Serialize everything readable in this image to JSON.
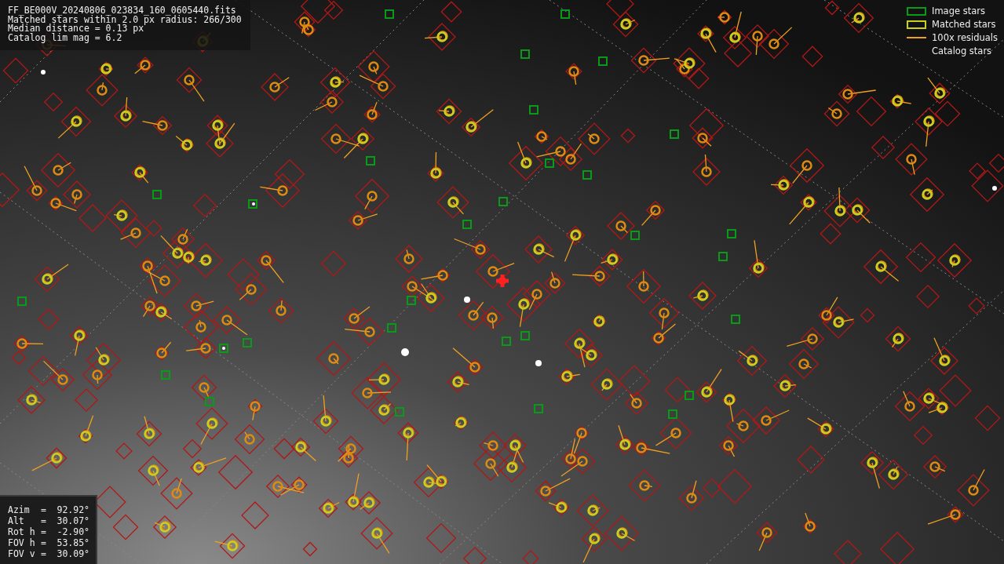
{
  "header": {
    "lines": [
      "FF_BE000V_20240806_023834_160_0605440.fits",
      "Matched stars within 2.0 px radius: 266/300",
      "Median distance = 0.13 px",
      "Catalog lim mag = 6.2"
    ]
  },
  "legend": [
    {
      "kind": "image",
      "label": "Image stars"
    },
    {
      "kind": "matched",
      "label": "Matched stars"
    },
    {
      "kind": "residual",
      "label": "100x residuals"
    },
    {
      "kind": "catalog",
      "label": "Catalog stars"
    }
  ],
  "pointing": [
    {
      "label": "Azim",
      "sep": "=",
      "value": "92.92°"
    },
    {
      "label": "Alt",
      "sep": "=",
      "value": "30.07°"
    },
    {
      "label": "Rot h",
      "sep": "=",
      "value": "-2.90°"
    },
    {
      "label": "FOV h",
      "sep": "=",
      "value": "53.85°"
    },
    {
      "label": "FOV v",
      "sep": "=",
      "value": "30.09°"
    }
  ]
}
